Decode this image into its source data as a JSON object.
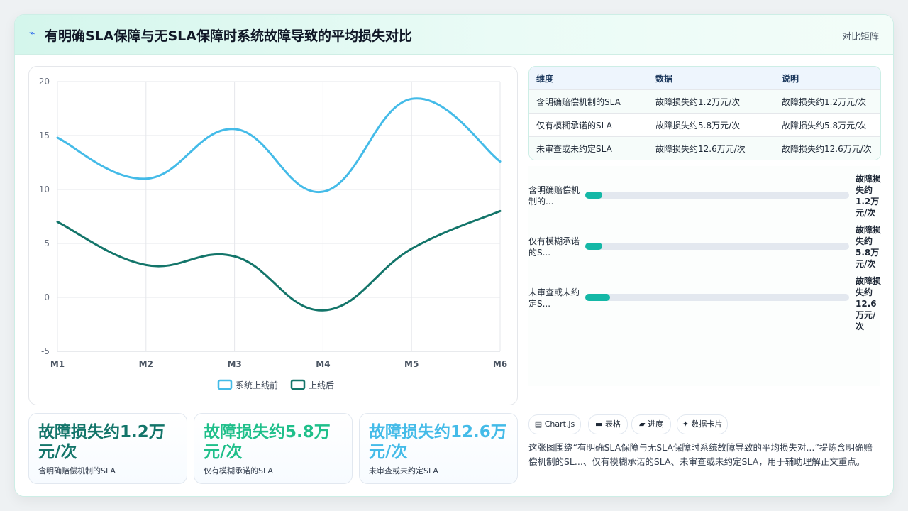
{
  "header": {
    "icon": "lightning-icon",
    "title": "有明确SLA保障与无SLA保障时系统故障导致的平均损失对比",
    "tag": "对比矩阵"
  },
  "chart_data": {
    "type": "line",
    "categories": [
      "M1",
      "M2",
      "M3",
      "M4",
      "M5",
      "M6"
    ],
    "series": [
      {
        "name": "系统上线前",
        "values": [
          14.8,
          11.0,
          15.6,
          9.8,
          18.4,
          12.6
        ],
        "color": "#44bbe8"
      },
      {
        "name": "上线后",
        "values": [
          7.0,
          3.0,
          3.8,
          -1.2,
          4.5,
          8.0
        ],
        "color": "#13756a"
      }
    ],
    "ylim": [
      -5,
      20
    ],
    "yticks": [
      -5,
      0,
      5,
      10,
      15,
      20
    ],
    "grid": true,
    "legend": "bottom"
  },
  "table": {
    "headers": [
      "维度",
      "数据",
      "说明"
    ],
    "rows": [
      [
        "含明确赔偿机制的SLA",
        "故障损失约1.2万元/次",
        "故障损失约1.2万元/次"
      ],
      [
        "仅有模糊承诺的SLA",
        "故障损失约5.8万元/次",
        "故障损失约5.8万元/次"
      ],
      [
        "未审查或未约定SLA",
        "故障损失约12.6万元/次",
        "故障损失约12.6万元/次"
      ]
    ]
  },
  "progress": [
    {
      "label": "含明确赔偿机制的...",
      "value_text": "故障损失约1.2万元/次",
      "fraction": 0.065
    },
    {
      "label": "仅有模糊承诺的S...",
      "value_text": "故障损失约5.8万元/次",
      "fraction": 0.065
    },
    {
      "label": "未审查或未约定S...",
      "value_text": "故障损失约12.6万元/次",
      "fraction": 0.095
    }
  ],
  "stats": [
    {
      "value": "故障损失约1.2万元/次",
      "label": "含明确赔偿机制的SLA",
      "color": "#13756a"
    },
    {
      "value": "故障损失约5.8万元/次",
      "label": "仅有模糊承诺的SLA",
      "color": "#1fbf8a"
    },
    {
      "value": "故障损失约12.6万元/次",
      "label": "未审查或未约定SLA",
      "color": "#44bbe8"
    }
  ],
  "chips": [
    {
      "icon": "chart-icon",
      "glyph": "▤",
      "label": "Chart.js"
    },
    {
      "icon": "table-icon",
      "glyph": "▬",
      "label": "表格"
    },
    {
      "icon": "progress-icon",
      "glyph": "▰",
      "label": "进度"
    },
    {
      "icon": "card-icon",
      "glyph": "✦",
      "label": "数据卡片"
    }
  ],
  "description": "这张图围绕“有明确SLA保障与无SLA保障时系统故障导致的平均损失对...”提炼含明确赔偿机制的SL...、仅有模糊承诺的SLA、未审查或未约定SLA，用于辅助理解正文重点。"
}
